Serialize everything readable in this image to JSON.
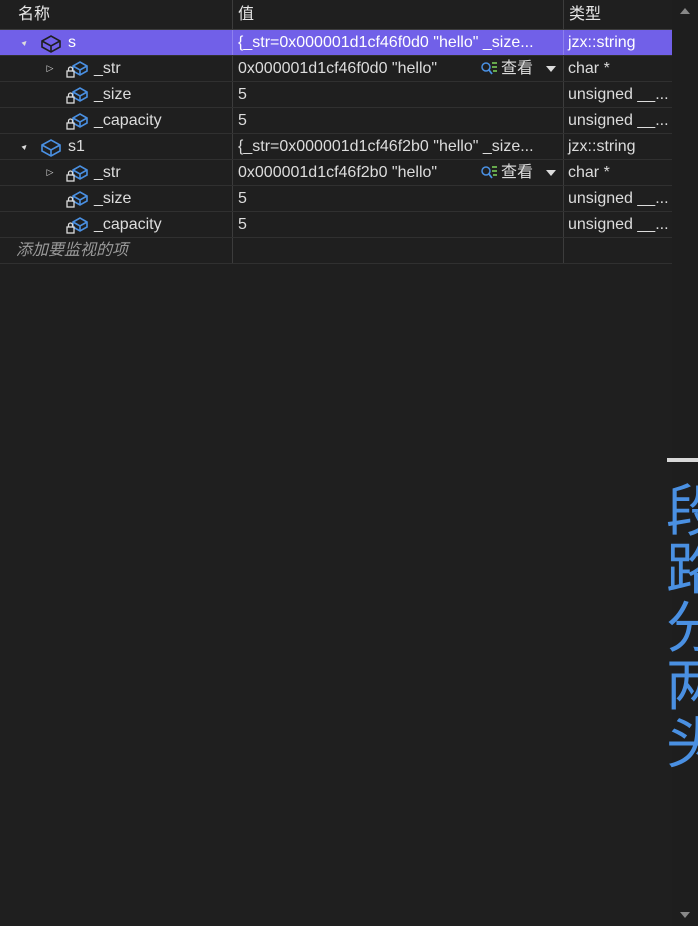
{
  "columns": {
    "name": "名称",
    "value": "值",
    "type": "类型"
  },
  "rows": [
    {
      "name": "s",
      "value": "{_str=0x000001d1cf46f0d0 \"hello\" _size...",
      "type": "jzx::string",
      "expander": "▲",
      "icon": "class-object-icon"
    },
    {
      "name": "_str",
      "value": "0x000001d1cf46f0d0 \"hello\"",
      "type": "char *",
      "expander": "▷",
      "icon": "private-field-icon",
      "view_label": "查看"
    },
    {
      "name": "_size",
      "value": "5",
      "type": "unsigned __...",
      "icon": "private-field-icon"
    },
    {
      "name": "_capacity",
      "value": "5",
      "type": "unsigned __...",
      "icon": "private-field-icon"
    },
    {
      "name": "s1",
      "value": "{_str=0x000001d1cf46f2b0 \"hello\" _size...",
      "type": "jzx::string",
      "expander": "▲",
      "icon": "class-object-icon"
    },
    {
      "name": "_str",
      "value": "0x000001d1cf46f2b0 \"hello\"",
      "type": "char *",
      "expander": "▷",
      "icon": "private-field-icon",
      "view_label": "查看"
    },
    {
      "name": "_size",
      "value": "5",
      "type": "unsigned __...",
      "icon": "private-field-icon"
    },
    {
      "name": "_capacity",
      "value": "5",
      "type": "unsigned __...",
      "icon": "private-field-icon"
    }
  ],
  "add_watch_hint": "添加要监视的项",
  "overlay_text": "段路分两头",
  "colors": {
    "background": "#1f1f1f",
    "selection": "#7160e8",
    "icon_blue": "#4a90e2",
    "text": "#dcdcdc"
  }
}
